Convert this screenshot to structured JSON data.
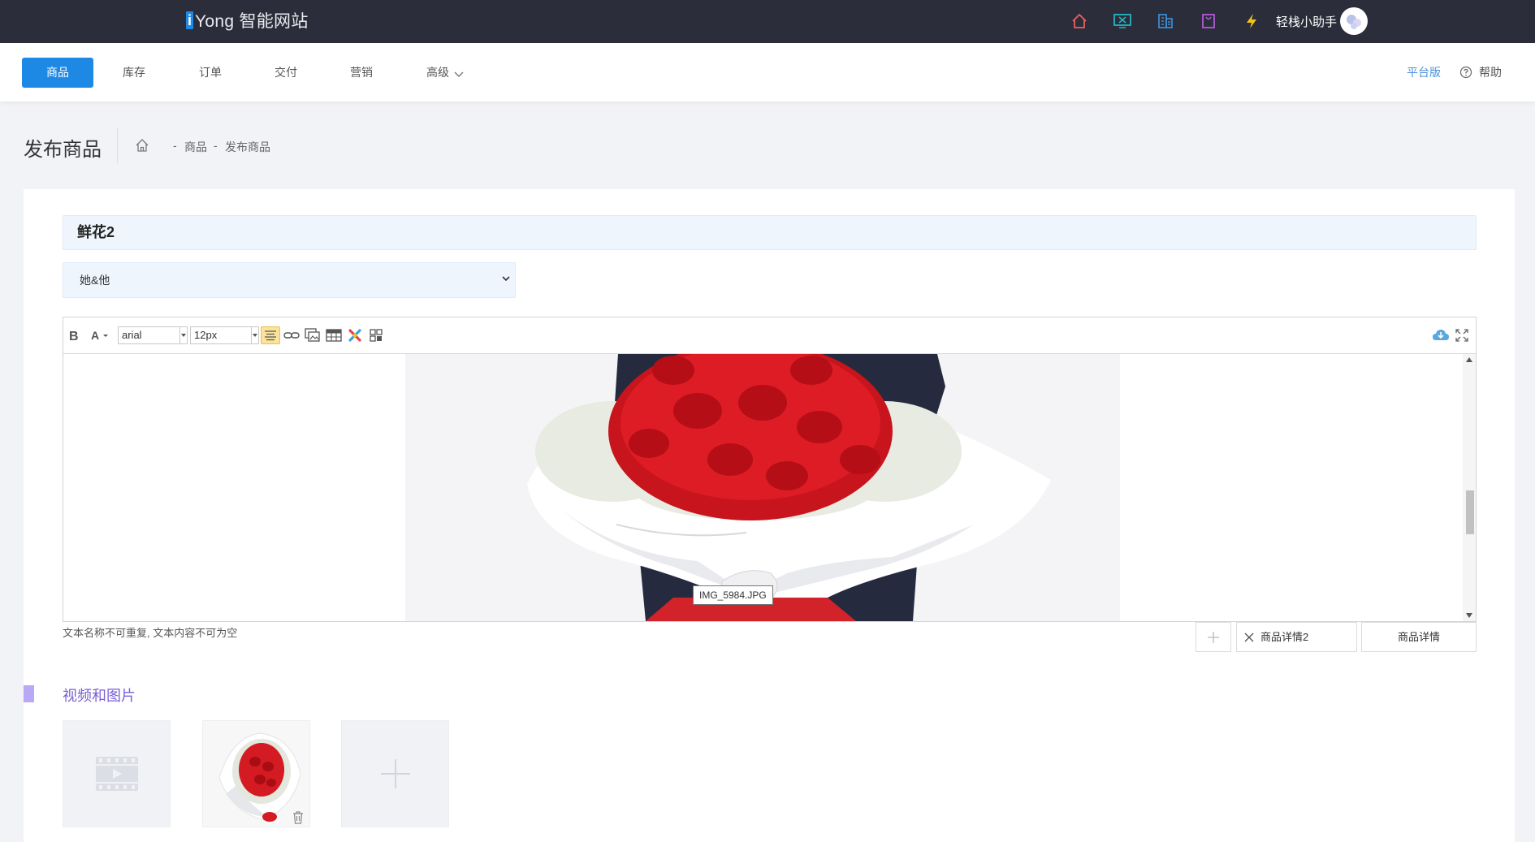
{
  "app": {
    "logo_text": "Yong 智能网站",
    "logo_letter": "i",
    "top_icons": [
      "home-icon",
      "monitor-icon",
      "building-icon",
      "bag-icon",
      "lightning-icon"
    ],
    "user_name": "轻栈小助手"
  },
  "nav": {
    "items": [
      {
        "label": "商品",
        "active": true
      },
      {
        "label": "库存",
        "active": false
      },
      {
        "label": "订单",
        "active": false
      },
      {
        "label": "交付",
        "active": false
      },
      {
        "label": "营销",
        "active": false
      },
      {
        "label": "高级",
        "active": false
      }
    ],
    "platform_link": "平台版",
    "help_link": "帮助"
  },
  "header": {
    "title": "发布商品",
    "breadcrumb": [
      "商品",
      "发布商品"
    ],
    "separator": "-"
  },
  "form": {
    "product_name": "鲜花2",
    "category": "她&他"
  },
  "editor": {
    "font_family": "arial",
    "font_size": "12px",
    "toolbar_icons": [
      "bold-icon",
      "font-color-icon",
      "align-icon",
      "link-icon",
      "image-icon",
      "table-icon",
      "widget-icon",
      "grid-icon",
      "cloud-icon",
      "fullscreen-icon"
    ],
    "image_caption": "IMG_5984.JPG",
    "hint": "文本名称不可重复, 文本内容不可为空",
    "tabs": [
      "商品详情2",
      "商品详情"
    ]
  },
  "media": {
    "section_title": "视频和图片",
    "tiles": [
      "video-placeholder-icon",
      "bouquet-thumbnail",
      "add-icon"
    ]
  },
  "colors": {
    "topbar": "#2b2d3b",
    "accent": "#1e88e5",
    "section_accent": "#7a5fd6"
  }
}
